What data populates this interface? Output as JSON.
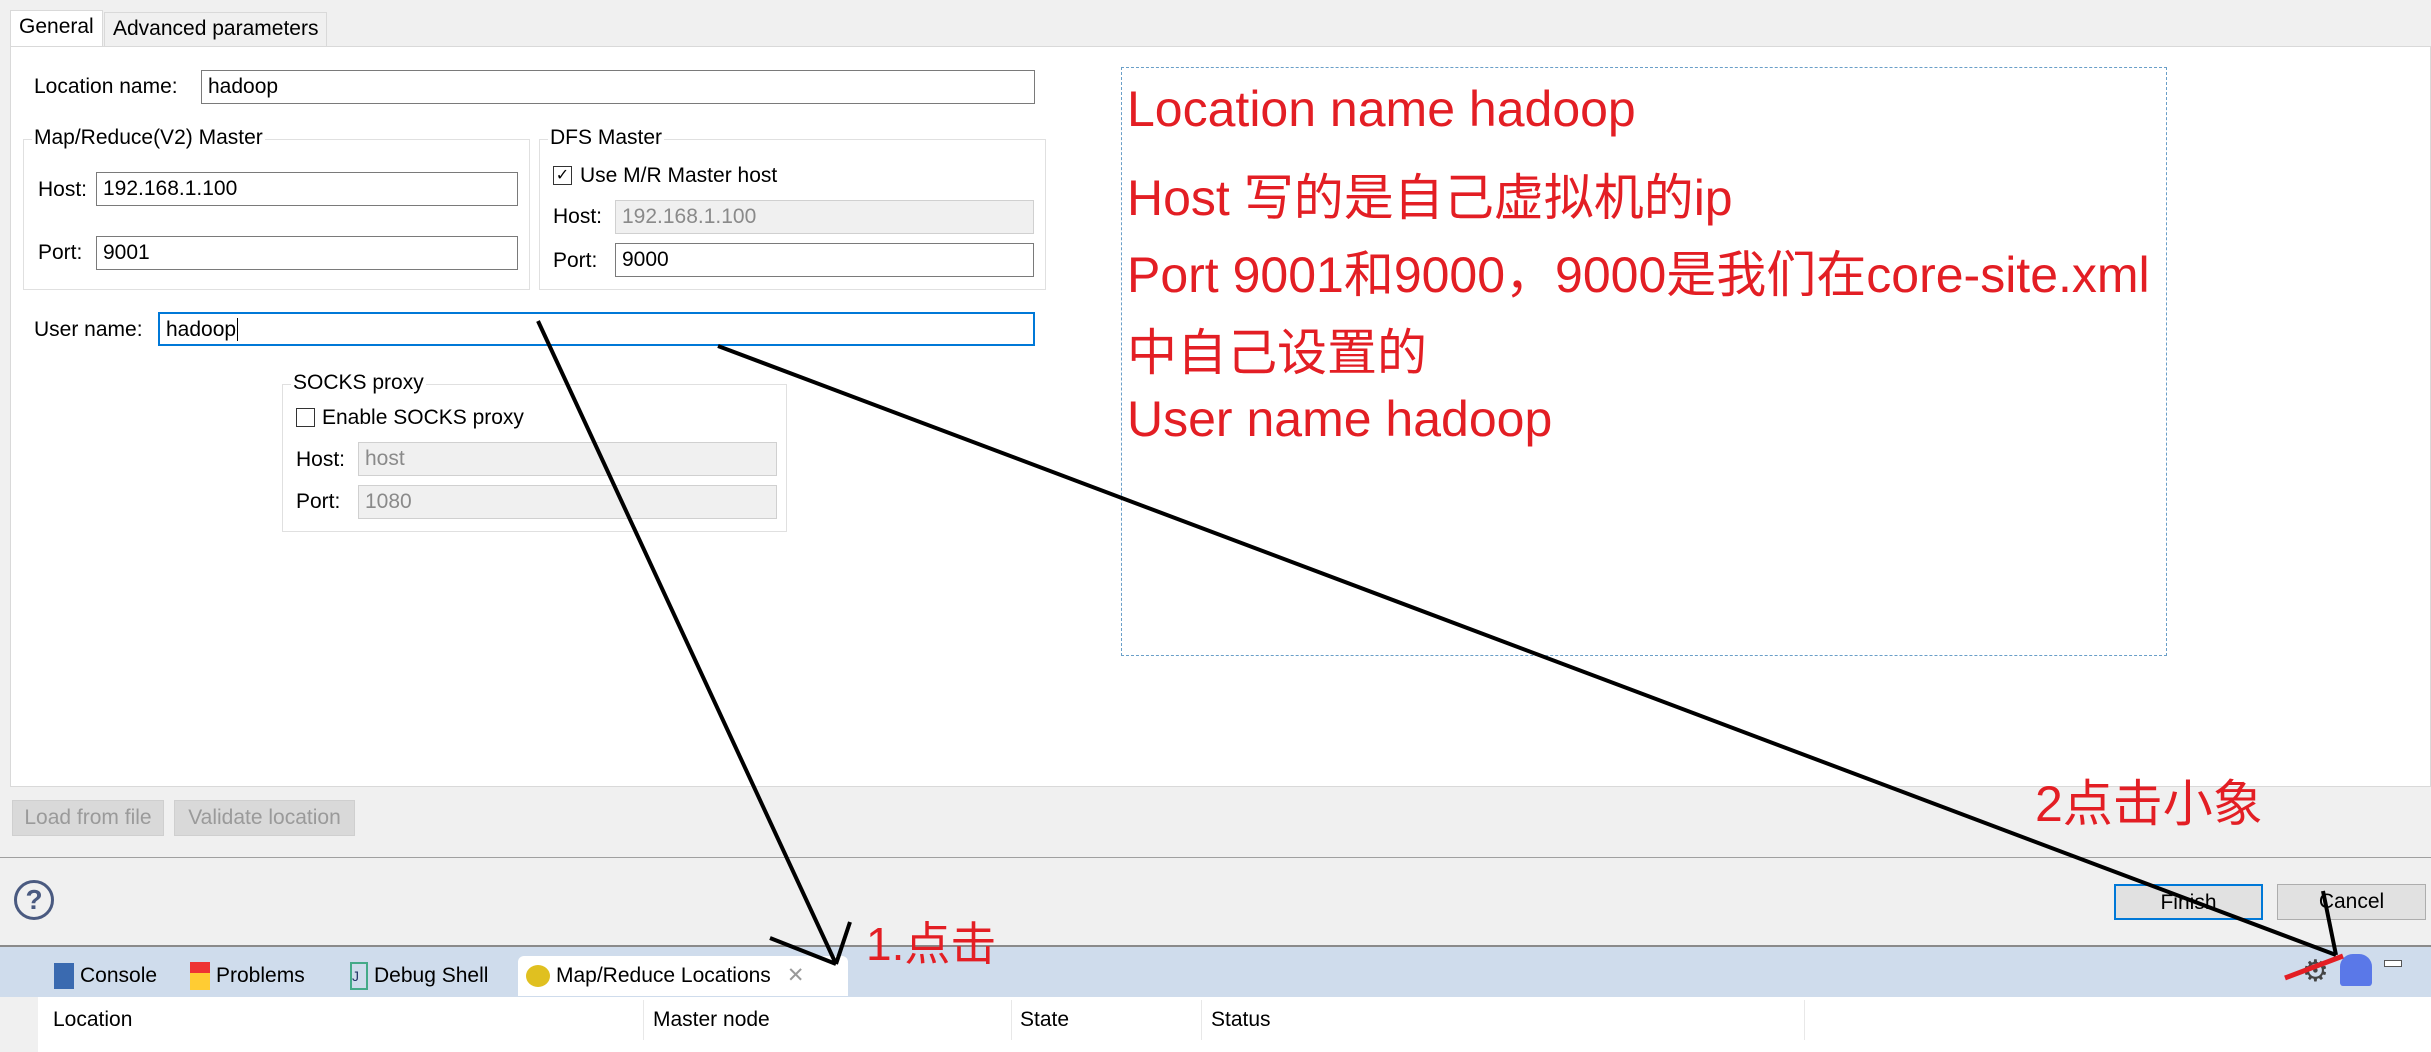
{
  "tabs": {
    "general": "General",
    "advanced": "Advanced parameters"
  },
  "form": {
    "location_name_label": "Location name:",
    "location_name": "hadoop",
    "mr_master": {
      "title": "Map/Reduce(V2) Master",
      "host_label": "Host:",
      "host": "192.168.1.100",
      "port_label": "Port:",
      "port": "9001"
    },
    "dfs_master": {
      "title": "DFS Master",
      "use_mr_label": "Use M/R Master host",
      "use_mr_checked": true,
      "host_label": "Host:",
      "host": "192.168.1.100",
      "port_label": "Port:",
      "port": "9000"
    },
    "user_name_label": "User name:",
    "user_name": "hadoop",
    "socks": {
      "title": "SOCKS proxy",
      "enable_label": "Enable SOCKS proxy",
      "enable_checked": false,
      "host_label": "Host:",
      "host": "host",
      "port_label": "Port:",
      "port": "1080"
    }
  },
  "buttons": {
    "load": "Load from file",
    "validate": "Validate location",
    "finish": "Finish",
    "cancel": "Cancel",
    "help": "?"
  },
  "annotation": {
    "lines": [
      "Location name   hadoop",
      "Host 写的是自己虚拟机的ip",
      "Port 9001和9000，9000是我们在core-site.xml",
      "中自己设置的",
      "User name  hadoop"
    ],
    "step1": "1.点击",
    "step2": "2点击小象",
    "color": "#e31e24"
  },
  "bottom": {
    "tabs": [
      "Console",
      "Problems",
      "Debug Shell",
      "Map/Reduce Locations"
    ],
    "columns": [
      "Location",
      "Master node",
      "State",
      "Status"
    ]
  }
}
